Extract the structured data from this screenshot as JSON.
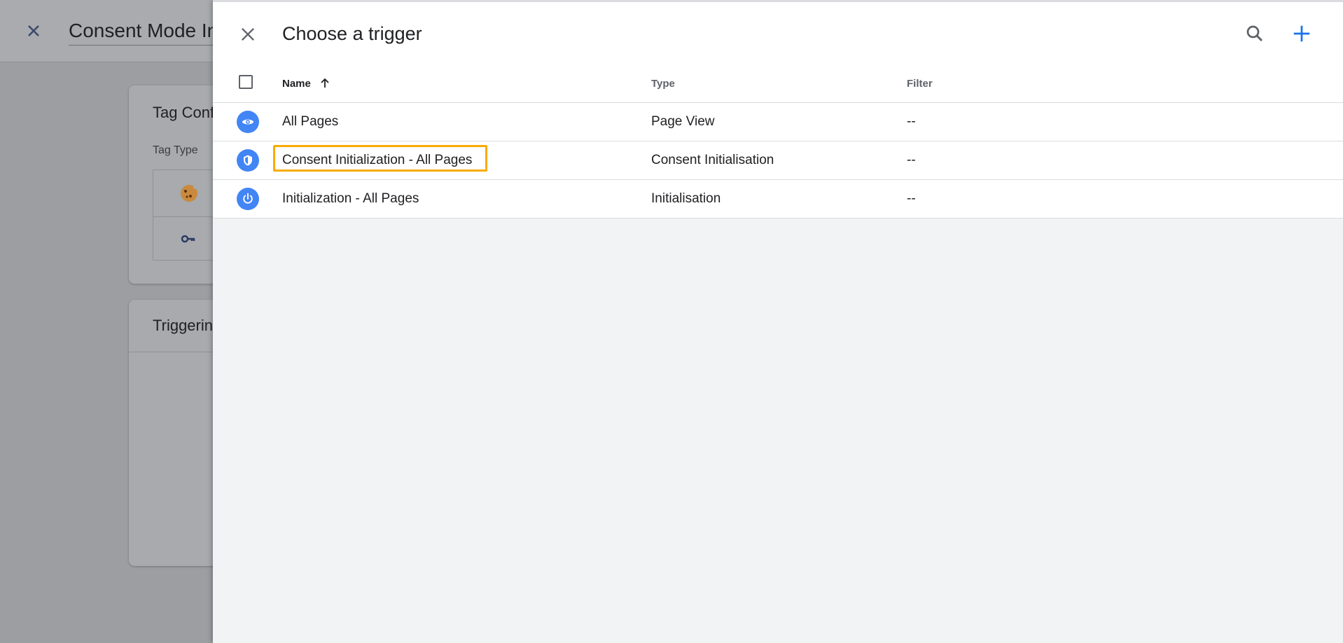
{
  "background": {
    "tag_name_value": "Consent Mode In",
    "card_tag_config_title": "Tag Conf",
    "tag_type_label": "Tag Type",
    "card_triggering_title": "Triggerin"
  },
  "panel": {
    "title": "Choose a trigger",
    "columns": {
      "name": "Name",
      "type": "Type",
      "filter": "Filter"
    },
    "rows": [
      {
        "icon": "eye-icon",
        "name": "All Pages",
        "type": "Page View",
        "filter": "--"
      },
      {
        "icon": "shield-icon",
        "name": "Consent Initialization - All Pages",
        "type": "Consent Initialisation",
        "filter": "--"
      },
      {
        "icon": "power-icon",
        "name": "Initialization - All Pages",
        "type": "Initialisation",
        "filter": "--"
      }
    ]
  },
  "colors": {
    "accent": "#1a73e8",
    "trigger_icon_bg": "#4285f4",
    "highlight": "#f9ab00",
    "overlay": "#9c9ea1"
  }
}
